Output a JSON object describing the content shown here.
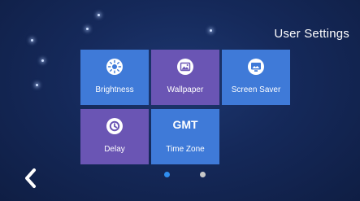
{
  "header": {
    "title": "User Settings"
  },
  "tiles": [
    {
      "label": "Brightness",
      "icon": "brightness-icon",
      "color": "#3f7ad8"
    },
    {
      "label": "Wallpaper",
      "icon": "wallpaper-icon",
      "color": "#6a55b4"
    },
    {
      "label": "Screen Saver",
      "icon": "screen-saver-icon",
      "color": "#3f7ad8"
    },
    {
      "label": "Delay",
      "icon": "delay-icon",
      "color": "#6a55b4"
    },
    {
      "label": "Time Zone",
      "icon_text": "GMT",
      "color": "#3f7ad8"
    }
  ],
  "pager": {
    "pages": 2,
    "current": 1,
    "active_color": "#2f8ef0",
    "inactive_color": "#c8c8c8"
  },
  "nav": {
    "back_icon": "chevron-left-icon"
  }
}
